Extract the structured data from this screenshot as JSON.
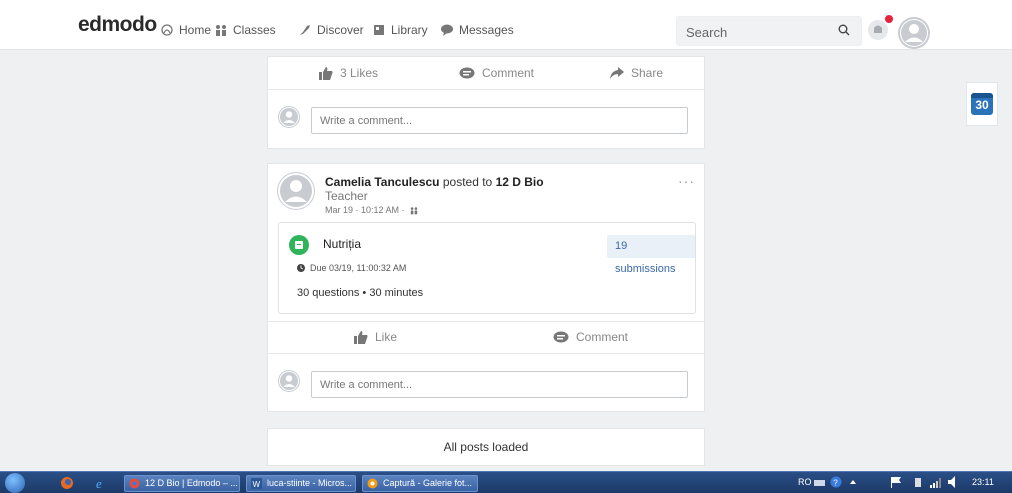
{
  "nav": {
    "logo": "edmodo",
    "home": "Home",
    "classes": "Classes",
    "discover": "Discover",
    "library": "Library",
    "messages": "Messages",
    "search_placeholder": "Search"
  },
  "post1": {
    "likes": "3 Likes",
    "comment": "Comment",
    "share": "Share",
    "comment_placeholder": "Write a comment..."
  },
  "post2": {
    "author": "Camelia Tanculescu",
    "posted_to": "posted to",
    "group": "12 D Bio",
    "role": "Teacher",
    "timestamp": "Mar 19 · 10:12 AM ·",
    "menu": "···",
    "assignment": {
      "title": "Nutriția",
      "submissions": "19 submissions",
      "due": "Due 03/19, 11:00:32 AM",
      "info": "30 questions • 30 minutes"
    },
    "like": "Like",
    "comment": "Comment",
    "comment_placeholder": "Write a comment..."
  },
  "feed": {
    "end_text": "All posts loaded"
  },
  "calendar": {
    "day": "30"
  },
  "taskbar": {
    "items": [
      "12 D Bio | Edmodo – ...",
      "luca-stiinte - Micros...",
      "Captură - Galerie fot..."
    ],
    "lang": "RO",
    "time": "23:11"
  },
  "colors": {
    "accent_blue": "#3a69a8",
    "assignment_green": "#2fb45a",
    "notification_red": "#e5243b"
  }
}
